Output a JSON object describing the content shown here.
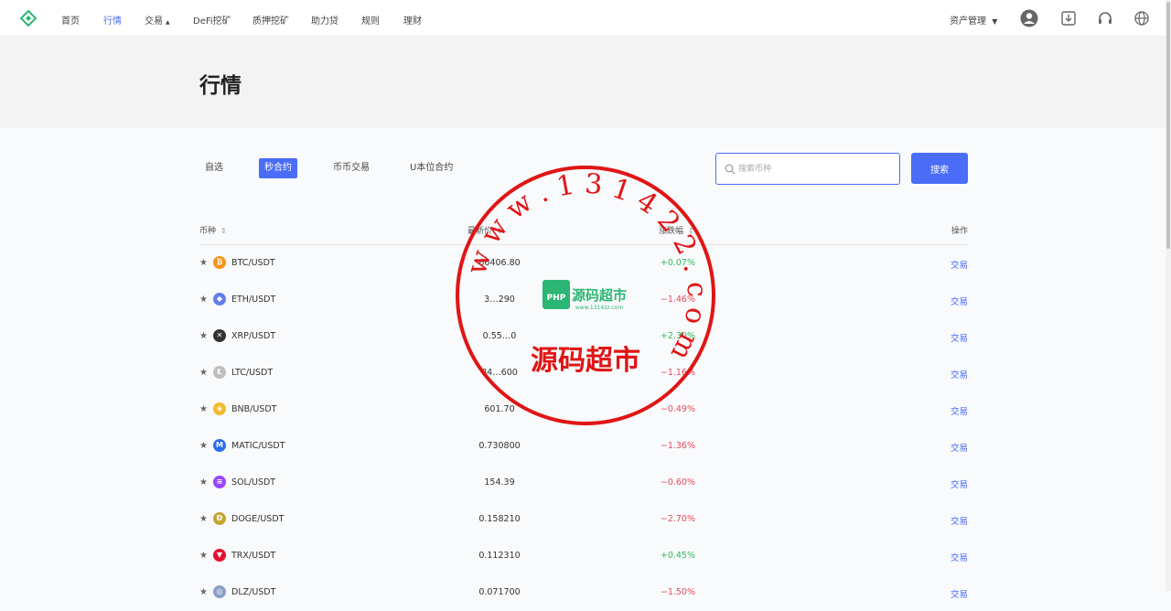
{
  "nav": {
    "items": [
      {
        "label": "首页",
        "active": false
      },
      {
        "label": "行情",
        "active": true
      },
      {
        "label": "交易",
        "active": false,
        "caret": "▲"
      },
      {
        "label": "DeFi挖矿",
        "active": false
      },
      {
        "label": "质押挖矿",
        "active": false
      },
      {
        "label": "助力贷",
        "active": false
      },
      {
        "label": "规则",
        "active": false
      },
      {
        "label": "理财",
        "active": false
      }
    ],
    "asset_menu": "资产管理",
    "icons": [
      "user-icon",
      "download-icon",
      "headset-icon",
      "globe-icon"
    ]
  },
  "hero": {
    "title": "行情"
  },
  "tabs": [
    {
      "label": "自选",
      "active": false
    },
    {
      "label": "秒合约",
      "active": true
    },
    {
      "label": "币币交易",
      "active": false
    },
    {
      "label": "U本位合约",
      "active": false
    }
  ],
  "search": {
    "placeholder": "搜索币种",
    "value": "",
    "button": "搜索"
  },
  "table": {
    "headers": {
      "coin": "币种",
      "price": "最新价",
      "change": "涨跌幅",
      "action": "操作"
    },
    "rows": [
      {
        "pair": "BTC/USDT",
        "price": "66406.80",
        "change": "+0.07%",
        "dir": "up",
        "action": "交易",
        "icon_color": "#f7931a",
        "icon_glyph": "₿"
      },
      {
        "pair": "ETH/USDT",
        "price": "3…290",
        "change": "−1.46%",
        "dir": "down",
        "action": "交易",
        "icon_color": "#627eea",
        "icon_glyph": "◆"
      },
      {
        "pair": "XRP/USDT",
        "price": "0.55…0",
        "change": "+2.30%",
        "dir": "up",
        "action": "交易",
        "icon_color": "#333333",
        "icon_glyph": "✕"
      },
      {
        "pair": "LTC/USDT",
        "price": "84…600",
        "change": "−1.16%",
        "dir": "down",
        "action": "交易",
        "icon_color": "#bfbfbf",
        "icon_glyph": "Ł"
      },
      {
        "pair": "BNB/USDT",
        "price": "601.70",
        "change": "−0.49%",
        "dir": "down",
        "action": "交易",
        "icon_color": "#f3ba2f",
        "icon_glyph": "◈"
      },
      {
        "pair": "MATIC/USDT",
        "price": "0.730800",
        "change": "−1.36%",
        "dir": "down",
        "action": "交易",
        "icon_color": "#2b6def",
        "icon_glyph": "M"
      },
      {
        "pair": "SOL/USDT",
        "price": "154.39",
        "change": "−0.60%",
        "dir": "down",
        "action": "交易",
        "icon_color": "#9945ff",
        "icon_glyph": "≡"
      },
      {
        "pair": "DOGE/USDT",
        "price": "0.158210",
        "change": "−2.70%",
        "dir": "down",
        "action": "交易",
        "icon_color": "#c2a633",
        "icon_glyph": "Ð"
      },
      {
        "pair": "TRX/USDT",
        "price": "0.112310",
        "change": "+0.45%",
        "dir": "up",
        "action": "交易",
        "icon_color": "#e5112e",
        "icon_glyph": "▼"
      },
      {
        "pair": "DLZ/USDT",
        "price": "0.071700",
        "change": "−1.50%",
        "dir": "down",
        "action": "交易",
        "icon_color": "#8aa0c4",
        "icon_glyph": "◎"
      }
    ]
  },
  "stamp": {
    "ring_text": "w w w . 1 3 1 4 2 2 . c o m",
    "center_text": "源码超市",
    "logo_text": "PHP",
    "logo_brand": "源码超市",
    "logo_url": "www.1314zz.com",
    "color": "#e01515"
  },
  "colors": {
    "accent": "#4a6cf7",
    "up": "#32b85d",
    "down": "#e34b5a",
    "brand": "#2bb673"
  }
}
